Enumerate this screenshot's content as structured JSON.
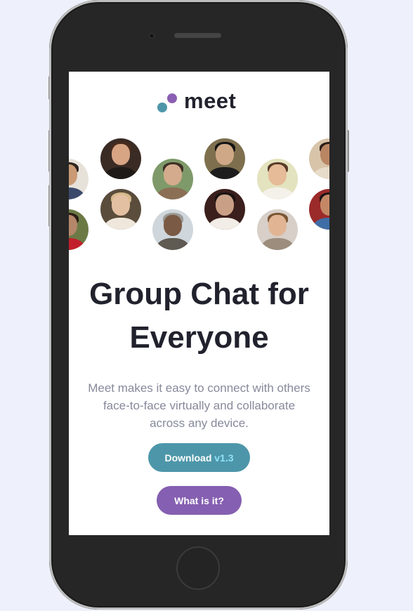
{
  "app": {
    "logo_text": "meet"
  },
  "hero": {
    "headline_line1": "Group Chat for",
    "headline_line2": "Everyone",
    "description_line1": "Meet makes it easy to connect with others",
    "description_line2": "face-to-face virtually and collaborate",
    "description_line3": "across any device."
  },
  "buttons": {
    "download_label": "Download",
    "download_version": "v1.3",
    "whatis_label": "What is it?"
  },
  "colors": {
    "accent_teal": "#4d96a9",
    "accent_purple": "#855fb1",
    "heading": "#21222d",
    "body_text": "#87899b"
  },
  "icons": {
    "logo": "two-dots-logo-icon"
  }
}
